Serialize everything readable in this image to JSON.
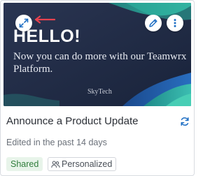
{
  "card": {
    "thumbnail": {
      "headline": "HELLO!",
      "body": "Now you can do more with our Teamwrx Platform.",
      "brand": "SkyTech",
      "expand_icon": "expand-arrows-icon",
      "edit_icon": "pencil-icon",
      "more_icon": "more-vertical-icon",
      "annotation_arrow_color": "#e8424f"
    },
    "title": "Announce a Product Update",
    "refresh_icon": "refresh-icon",
    "subtitle": "Edited in the past 14 days",
    "badges": {
      "shared": "Shared",
      "personalized": "Personalized",
      "personalized_icon": "people-icon"
    },
    "colors": {
      "thumbnail_bg": "#1e2a44",
      "accent_teal": "#2bb6a3",
      "accent_blue": "#1f6fc4",
      "shared_bg": "#e8f4ea",
      "shared_text": "#2f7d3b"
    }
  }
}
